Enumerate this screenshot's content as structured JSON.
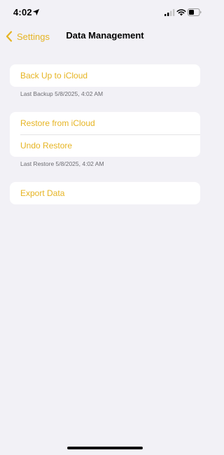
{
  "status_bar": {
    "time": "4:02"
  },
  "nav": {
    "back_label": "Settings",
    "title": "Data Management"
  },
  "backup_group": {
    "items": [
      {
        "label": "Back Up to iCloud"
      }
    ],
    "footer": "Last Backup 5/8/2025, 4:02 AM"
  },
  "restore_group": {
    "items": [
      {
        "label": "Restore from iCloud"
      },
      {
        "label": "Undo Restore"
      }
    ],
    "footer": "Last Restore 5/8/2025, 4:02 AM"
  },
  "export_group": {
    "items": [
      {
        "label": "Export Data"
      }
    ]
  },
  "colors": {
    "accent": "#e6b422",
    "background": "#f2f1f6",
    "cell": "#ffffff",
    "footnote": "#6d6d72"
  },
  "icons": [
    "location-arrow-icon",
    "cellular-signal-icon",
    "wifi-icon",
    "battery-icon",
    "chevron-left-icon"
  ]
}
